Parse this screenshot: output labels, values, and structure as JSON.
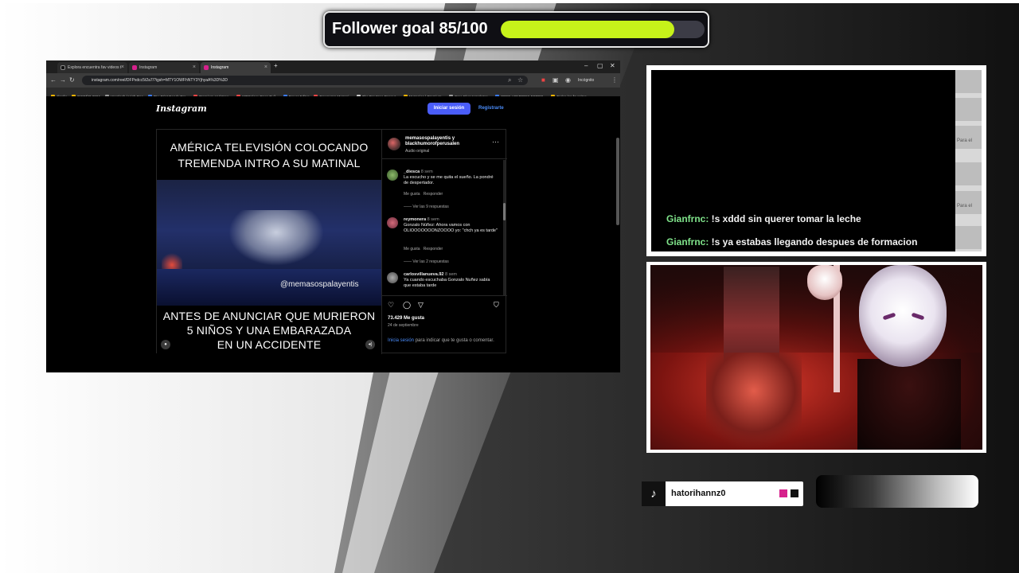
{
  "goal": {
    "label": "Follower goal 85/100",
    "progress": 0.85,
    "fill_color": "#c6f21a"
  },
  "browser": {
    "tabs": [
      {
        "title": "Explora encuentra fav videos t",
        "active": false
      },
      {
        "title": "Instagram",
        "active": false
      },
      {
        "title": "Instagram",
        "active": true
      }
    ],
    "window_controls": [
      "–",
      "▢",
      "✕"
    ],
    "url": "instagram.com/reel/DFPxdcc5t2a7/?igsh=MTY1OWFhNTY3YjhyaA%3D%3D",
    "incognito_label": "Incógnito",
    "bookmarks": [
      "diseño",
      "DISEÑO 2024",
      "Unsplash | High Res",
      "85+ Print Ready Bro...",
      "Premium and Free...",
      "WPGalaxy Page Buil...",
      "Power Editor",
      "Freepornn Mozapi...",
      "The Top Free Resour...",
      "Mozapica | Premium...",
      "Free Flyer templates...",
      "FREE HOMBRES FOTOG...",
      "Todos los favoritos"
    ],
    "bookmark_colors": [
      "#f4b400",
      "#f4b400",
      "#999999",
      "#3b7bf4",
      "#e44",
      "#e44",
      "#3b7bf4",
      "#e44",
      "#ccc",
      "#f4b400",
      "#999",
      "#3b7bf4",
      "#f4b400"
    ]
  },
  "instagram": {
    "logo": "Instagram",
    "login_button": "Iniciar sesión",
    "register_link": "Registrarte",
    "video": {
      "top_caption_1": "AMÉRICA TELEVISIÓN COLOCANDO",
      "top_caption_2": "TREMENDA INTRO A SU MATINAL",
      "watermark": "@memasospalayentis",
      "bottom_caption_1": "ANTES DE ANUNCIAR QUE MURIERON",
      "bottom_caption_2": "5 NIÑOS Y UNA EMBARAZADA",
      "bottom_caption_3": "EN UN ACCIDENTE"
    },
    "post": {
      "users": "memasospalayentis y blackhumorofperusalen",
      "audio": "Audio original",
      "more": "···",
      "comments": [
        {
          "user": "_diesca",
          "time": "8 sem",
          "text": "La escucho y se me quita el sueño. La pondré de despertador.",
          "like": "Me gusta",
          "reply": "Responder",
          "replies": "Ver las 9 respuestas"
        },
        {
          "user": "reymonera",
          "time": "8 sem",
          "text": "Gonzalo Núñez: Ahora vamos con OLIOOOOOOONZOOOO yo: \"chch ya es tarde\"",
          "like": "Me gusta",
          "reply": "Responder",
          "replies": "Ver las 2 respuestas"
        },
        {
          "user": "carlosvillanueva.92",
          "time": "8 sem",
          "text": "Ya cuando escuchaba Gonzalo Nuñez sabía que estaba tarde",
          "like": "",
          "reply": "",
          "replies": ""
        }
      ],
      "likes": "73.429 Me gusta",
      "date": "24 de septiembre",
      "login_hint_link": "Inicia sesión",
      "login_hint_rest": " para indicar que te gusta o comentar."
    }
  },
  "chat": {
    "messages": [
      {
        "user": "Gianfrnc:",
        "text": " !s xddd sin querer tomar la leche"
      },
      {
        "user": "Gianfrnc:",
        "text": " !s ya estabas llegando despues de formacion"
      }
    ],
    "strip_text": [
      "Para el",
      "Para el"
    ]
  },
  "social": {
    "platform_icon": "tiktok-icon",
    "glyph": "♪",
    "handle": "hatorihannz0",
    "square_colors": [
      "#d6218c",
      "#111111"
    ]
  }
}
